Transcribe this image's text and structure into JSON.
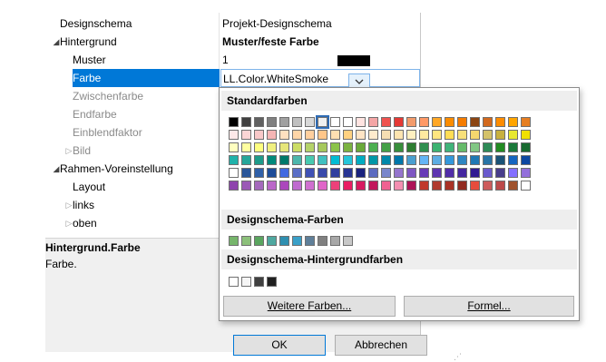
{
  "grid": {
    "header": {
      "name": "Designschema",
      "value": "Projekt-Designschema"
    },
    "rows": [
      {
        "name": "Hintergrund",
        "value": "Muster/feste Farbe",
        "expander": "◢"
      },
      {
        "name": "Muster",
        "value": "1"
      },
      {
        "name": "Farbe",
        "value": "LL.Color.WhiteSmoke"
      },
      {
        "name": "Zwischenfarbe",
        "value": ""
      },
      {
        "name": "Endfarbe",
        "value": ""
      },
      {
        "name": "Einblendfaktor",
        "value": ""
      },
      {
        "name": "Bild",
        "value": "",
        "expander": "▷"
      },
      {
        "name": "Rahmen-Voreinstellung",
        "value": "",
        "expander": "◢"
      },
      {
        "name": "Layout",
        "value": ""
      },
      {
        "name": "links",
        "value": "",
        "expander": "▷"
      },
      {
        "name": "oben",
        "value": "",
        "expander": "▷"
      }
    ]
  },
  "description": {
    "title": "Hintergrund.Farbe",
    "text": "Farbe."
  },
  "buttons": {
    "ok": "OK",
    "cancel": "Abbrechen"
  },
  "popup": {
    "section_standard": "Standardfarben",
    "section_schema": "Designschema-Farben",
    "section_background": "Designschema-Hintergrundfarben",
    "more_colors_label": "Weitere Farben...",
    "formula_label": "Formel...",
    "standard_colors": [
      [
        "#000000",
        "#404040",
        "#606060",
        "#808080",
        "#a0a0a0",
        "#c0c0c0",
        "#d8d8d8",
        "#f0f0f0",
        "#ffffff",
        "#ffffff",
        "#ffe4e1",
        "#f4a6a6",
        "#ef5350",
        "#e53935",
        "#f39b6b",
        "#ff9966",
        "#ffa726",
        "#fb8c00",
        "#f57c00",
        "#8b4513",
        "#d2691e",
        "#ff8c00",
        "#ffa500",
        "#e67e22"
      ],
      [
        "#fde8e8",
        "#fbd5d5",
        "#f8c8c8",
        "#f5b5b5",
        "#ffe0c0",
        "#ffd6a8",
        "#ffcf9e",
        "#ffc68a",
        "#ffe0b2",
        "#ffd180",
        "#ffe4c4",
        "#ffebcd",
        "#f5deb3",
        "#fde4b0",
        "#fff0c0",
        "#ffeaa0",
        "#ffe680",
        "#ffdd55",
        "#f7e07a",
        "#f5d76e",
        "#d4c26a",
        "#c8b040",
        "#e8e830",
        "#f0e000"
      ],
      [
        "#ffffc0",
        "#ffffa0",
        "#ffff80",
        "#f0f080",
        "#e6e67a",
        "#ccdd66",
        "#b5d36a",
        "#a6c85c",
        "#8bc34a",
        "#7cb342",
        "#6aaa3a",
        "#4caf50",
        "#43a047",
        "#388e3c",
        "#2e7d32",
        "#2f8f4f",
        "#3cb371",
        "#40b47a",
        "#66bb6a",
        "#81c784",
        "#2e8b57",
        "#228b22",
        "#1b7a3a",
        "#186a30"
      ],
      [
        "#20b2aa",
        "#26a69a",
        "#1e9b8a",
        "#00897b",
        "#00796b",
        "#4db6ac",
        "#48c9b0",
        "#40c0c0",
        "#00bcd4",
        "#26c6da",
        "#00acc1",
        "#0097a7",
        "#0088aa",
        "#0077aa",
        "#4a9fd0",
        "#64b5f6",
        "#5dade2",
        "#3498db",
        "#2e86c1",
        "#1f78b4",
        "#2874a6",
        "#1a5276",
        "#1565c0",
        "#0d47a1"
      ],
      [
        "#ffffff",
        "#2b579a",
        "#3060a8",
        "#1e4d99",
        "#4169e1",
        "#5b6fc7",
        "#3f51b5",
        "#3949ab",
        "#303f9f",
        "#283593",
        "#1a237e",
        "#5c6bc0",
        "#7986cb",
        "#9575cd",
        "#7e57c2",
        "#673ab7",
        "#5e35b1",
        "#512da8",
        "#4527a0",
        "#311b92",
        "#6a5acd",
        "#483d8b",
        "#8470ff",
        "#9370db"
      ],
      [
        "#8e44ad",
        "#9b59b6",
        "#a569bd",
        "#ba68c8",
        "#ab47bc",
        "#c06cd0",
        "#d070d0",
        "#e066c8",
        "#ec407a",
        "#e91e63",
        "#d81b60",
        "#c2185b",
        "#f06292",
        "#f48fb1",
        "#ad1457",
        "#c0392b",
        "#b03a2e",
        "#a93226",
        "#922b21",
        "#e74c3c",
        "#cd5c5c",
        "#bc4a4a",
        "#a0522d",
        "#ffffff"
      ]
    ],
    "schema_colors": [
      "#76b56b",
      "#8cc07a",
      "#5aa55f",
      "#4fa8a0",
      "#2f8fb0",
      "#3aa0c8",
      "#5f7f99",
      "#808080",
      "#a8a8a8",
      "#c8c8c8"
    ],
    "background_colors": [
      "#ffffff",
      "#f5f5f5",
      "#404040",
      "#202020"
    ]
  }
}
